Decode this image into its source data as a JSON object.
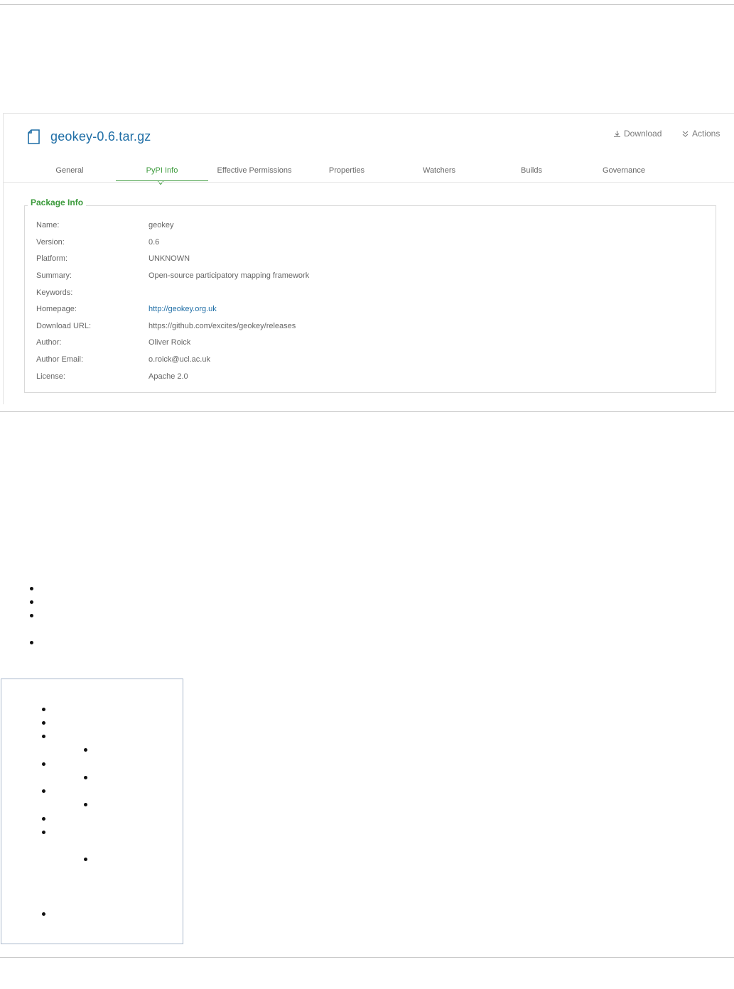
{
  "artifact": {
    "file_name": "geokey-0.6.tar.gz",
    "download_label": "Download",
    "actions_label": "Actions"
  },
  "tabs": [
    {
      "label": "General"
    },
    {
      "label": "PyPI Info"
    },
    {
      "label": "Effective Permissions"
    },
    {
      "label": "Properties"
    },
    {
      "label": "Watchers"
    },
    {
      "label": "Builds"
    },
    {
      "label": "Governance"
    }
  ],
  "package_info": {
    "legend": "Package Info",
    "rows": [
      {
        "label": "Name:",
        "value": "geokey"
      },
      {
        "label": "Version:",
        "value": "0.6"
      },
      {
        "label": "Platform:",
        "value": "UNKNOWN"
      },
      {
        "label": "Summary:",
        "value": "Open-source participatory mapping framework"
      },
      {
        "label": "Keywords:",
        "value": ""
      },
      {
        "label": "Homepage:",
        "value": "http://geokey.org.uk"
      },
      {
        "label": "Download URL:",
        "value": "https://github.com/excites/geokey/releases"
      },
      {
        "label": "Author:",
        "value": "Oliver Roick"
      },
      {
        "label": "Author Email:",
        "value": "o.roick@ucl.ac.uk"
      },
      {
        "label": "License:",
        "value": "Apache 2.0"
      }
    ]
  },
  "colors": {
    "accent_green": "#3b9a3b",
    "link_blue": "#1f6ea6"
  }
}
